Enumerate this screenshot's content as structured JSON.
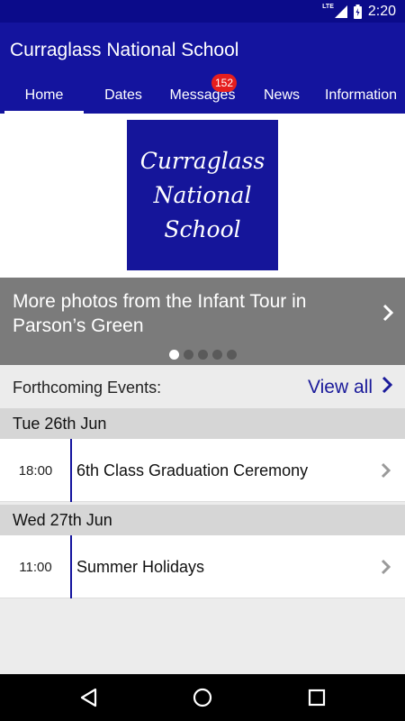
{
  "status_bar": {
    "network": "LTE",
    "time": "2:20"
  },
  "app": {
    "title": "Curraglass National School"
  },
  "tabs": [
    {
      "label": "Home",
      "active": true
    },
    {
      "label": "Dates"
    },
    {
      "label": "Messages",
      "badge": "152"
    },
    {
      "label": "News"
    },
    {
      "label": "Information"
    }
  ],
  "logo": {
    "line1": "Curraglass",
    "line2": "National",
    "line3": "School"
  },
  "carousel": {
    "caption": "More photos from the Infant Tour in Parson’s Green",
    "slides": 5,
    "active_slide": 1
  },
  "events": {
    "heading": "Forthcoming Events:",
    "view_all": "View all",
    "days": [
      {
        "date": "Tue 26th Jun",
        "items": [
          {
            "time": "18:00",
            "title": "6th Class Graduation Ceremony"
          }
        ]
      },
      {
        "date": "Wed 27th Jun",
        "items": [
          {
            "time": "11:00",
            "title": "Summer Holidays"
          }
        ]
      }
    ]
  },
  "colors": {
    "primary": "#14149e",
    "status_bar": "#0b0b8a",
    "badge": "#e61e1e",
    "carousel": "#7b7b7b",
    "day_header": "#d6d6d6"
  },
  "icons": {
    "nav": [
      "back-icon",
      "home-icon",
      "recents-icon"
    ]
  }
}
